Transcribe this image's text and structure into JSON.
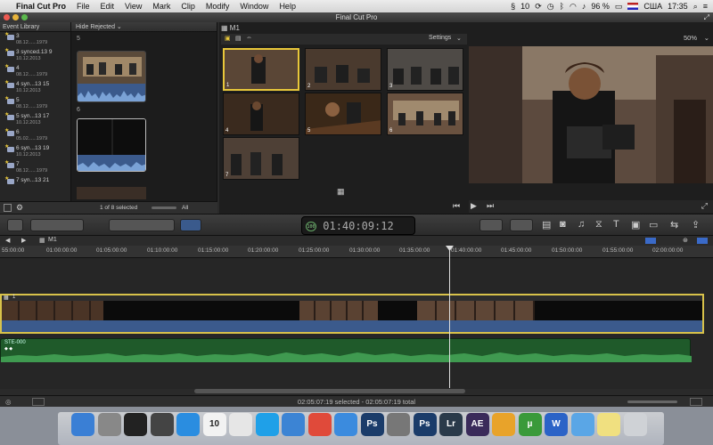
{
  "menubar": {
    "apple": "",
    "app_name": "Final Cut Pro",
    "items": [
      "File",
      "Edit",
      "View",
      "Mark",
      "Clip",
      "Modify",
      "Window",
      "Help"
    ],
    "notification_count": "10",
    "battery": "96 %",
    "input_source": "США",
    "clock": "17:35"
  },
  "window": {
    "title": "Final Cut Pro"
  },
  "event_library": {
    "header": "Event Library",
    "items": [
      {
        "name": "3",
        "date": "08.12......1979"
      },
      {
        "name": "3 synced.13 9",
        "date": "10.12.2013"
      },
      {
        "name": "4",
        "date": "08.12......1979"
      },
      {
        "name": "4 syn...13 15",
        "date": "10.12.2013"
      },
      {
        "name": "5",
        "date": "08.12......1979"
      },
      {
        "name": "5 syn...13 17",
        "date": "10.12.2013"
      },
      {
        "name": "6",
        "date": "05.02......1979"
      },
      {
        "name": "6 syn...13 19",
        "date": "10.12.2013"
      },
      {
        "name": "7",
        "date": "08.12......1979"
      },
      {
        "name": "7 syn...13 21",
        "date": ""
      }
    ]
  },
  "browser": {
    "filter": "Hide Rejected",
    "clip_labels": [
      "5",
      "6"
    ],
    "selection_status": "1 of 8 selected",
    "all_label": "All"
  },
  "angle_viewer": {
    "title": "M1",
    "settings": "Settings",
    "angles": [
      "1",
      "2",
      "3",
      "4",
      "5",
      "6",
      "7"
    ]
  },
  "viewer": {
    "zoom": "50%"
  },
  "timecode": {
    "value": "01:40:09:12",
    "percent": "100"
  },
  "timeline": {
    "project": "M1",
    "ruler": [
      "55:00:00",
      "01:00:00:00",
      "01:05:00:00",
      "01:10:00:00",
      "01:15:00:00",
      "01:20:00:00",
      "01:25:00:00",
      "01:30:00:00",
      "01:35:00:00",
      "01:40:00:00",
      "01:45:00:00",
      "01:50:00:00",
      "01:55:00:00",
      "02:00:00:00"
    ],
    "video_lane_label": "1",
    "audio_lane_label": "STE-000"
  },
  "status": {
    "text": "02:05:07:19 selected - 02:05:07:19 total"
  },
  "dock": {
    "calendar_day": "10",
    "apps": [
      {
        "name": "finder",
        "color": "#3a7fd5",
        "label": ""
      },
      {
        "name": "launchpad",
        "color": "#888",
        "label": ""
      },
      {
        "name": "final-cut",
        "color": "#222",
        "label": ""
      },
      {
        "name": "photos",
        "color": "#444",
        "label": ""
      },
      {
        "name": "app-store",
        "color": "#2a8de0",
        "label": ""
      },
      {
        "name": "calendar",
        "color": "#f2f2f2",
        "label": ""
      },
      {
        "name": "preview",
        "color": "#e6e6e6",
        "label": ""
      },
      {
        "name": "skype",
        "color": "#1fa0e8",
        "label": ""
      },
      {
        "name": "safari",
        "color": "#3c84d4",
        "label": ""
      },
      {
        "name": "chrome",
        "color": "#e04a3a",
        "label": ""
      },
      {
        "name": "itunes",
        "color": "#3b8bde",
        "label": ""
      },
      {
        "name": "photoshop",
        "color": "#1b3c6a",
        "label": "Ps"
      },
      {
        "name": "script-editor",
        "color": "#777",
        "label": ""
      },
      {
        "name": "photoshop-2",
        "color": "#1b3c6a",
        "label": "Ps"
      },
      {
        "name": "lightroom",
        "color": "#2a3a4a",
        "label": "Lr"
      },
      {
        "name": "after-effects",
        "color": "#3a2a5a",
        "label": "AE"
      },
      {
        "name": "app-tile",
        "color": "#e8a32a",
        "label": ""
      },
      {
        "name": "utorrent",
        "color": "#3a9a3a",
        "label": "µ"
      },
      {
        "name": "word",
        "color": "#2b63c7",
        "label": "W"
      },
      {
        "name": "finder-2",
        "color": "#5aa6e6",
        "label": ""
      },
      {
        "name": "stickies",
        "color": "#f0e080",
        "label": ""
      },
      {
        "name": "trash",
        "color": "#cfd2d6",
        "label": ""
      }
    ]
  }
}
